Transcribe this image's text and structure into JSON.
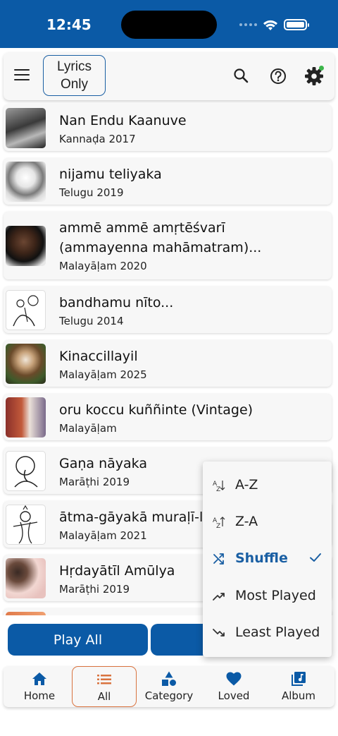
{
  "status_bar": {
    "time": "12:45"
  },
  "toolbar": {
    "lyrics_line1": "Lyrics",
    "lyrics_line2": "Only"
  },
  "songs": [
    {
      "title": "Nan Endu Kaanuve",
      "subtitle": "Kannaḍa 2017"
    },
    {
      "title": "nijamu teliyaka",
      "subtitle": "Telugu 2019"
    },
    {
      "title": "ammē ammē amṛtēśvarī (ammayenna mahāmatram)...",
      "subtitle": "Malayāḷam 2020"
    },
    {
      "title": "bandhamu nīto...",
      "subtitle": "Telugu 2014"
    },
    {
      "title": "Kinaccillayil",
      "subtitle": "Malayāḷam 2025"
    },
    {
      "title": "oru koccu kuññinte (Vintage)",
      "subtitle": "Malayāḷam"
    },
    {
      "title": "Gaṇa nāyaka",
      "subtitle": "Marāṭhi 2019"
    },
    {
      "title": "ātma-gāyakā muraḷī-lō",
      "subtitle": "Malayāḷam 2021"
    },
    {
      "title": "Hṛdayātīl Amūlya",
      "subtitle": "Marāṭhi 2019"
    }
  ],
  "play_bar": {
    "play_all": "Play All"
  },
  "sort_menu": {
    "items": [
      {
        "label": "A-Z",
        "icon": "sort-az-icon"
      },
      {
        "label": "Z-A",
        "icon": "sort-za-icon"
      },
      {
        "label": "Shuffle",
        "icon": "shuffle-icon",
        "selected": true
      },
      {
        "label": "Most Played",
        "icon": "trending-up-icon"
      },
      {
        "label": "Least Played",
        "icon": "trending-down-icon"
      }
    ]
  },
  "nav": {
    "items": [
      {
        "label": "Home",
        "icon": "home-icon"
      },
      {
        "label": "All",
        "icon": "list-icon",
        "active": true
      },
      {
        "label": "Category",
        "icon": "category-icon"
      },
      {
        "label": "Loved",
        "icon": "heart-icon"
      },
      {
        "label": "Album",
        "icon": "album-icon"
      }
    ]
  },
  "colors": {
    "primary": "#0b5aa6",
    "active_outline": "#d9733f",
    "badge": "#3cb54a",
    "card": "#f7f7f7"
  }
}
